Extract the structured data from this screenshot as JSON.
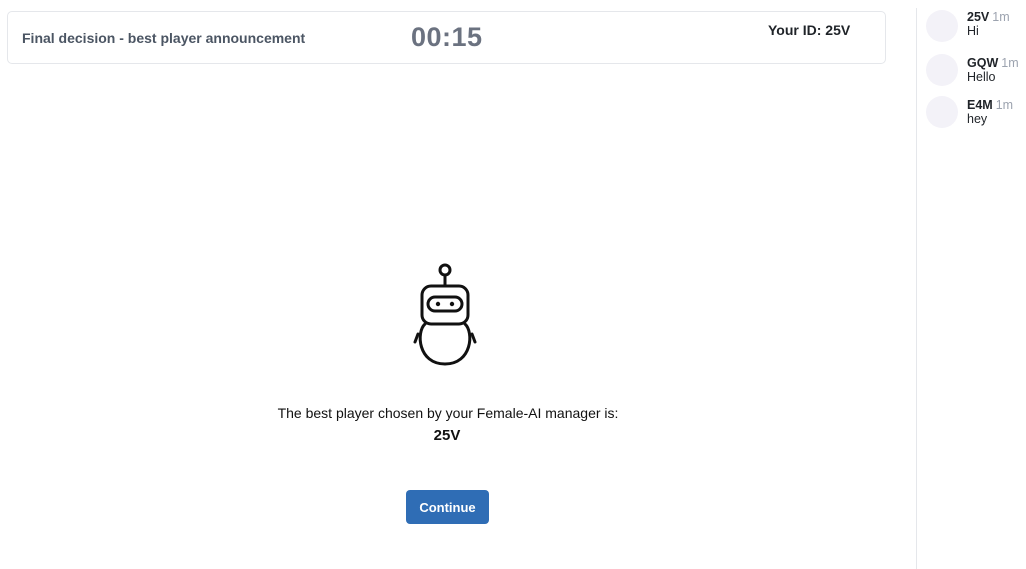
{
  "header": {
    "stage_title": "Final decision - best player announcement",
    "timer": "00:15",
    "your_id": "Your ID: 25V"
  },
  "main": {
    "robot_icon": "robot-icon",
    "announcement": "The best player chosen by your Female-AI manager is:",
    "winner": "25V",
    "continue_label": "Continue",
    "accent_color": "#2f6db5"
  },
  "chat": {
    "messages": [
      {
        "author": "25V",
        "time": "1m",
        "text": "Hi"
      },
      {
        "author": "GQW",
        "time": "1m",
        "text": "Hello"
      },
      {
        "author": "E4M",
        "time": "1m",
        "text": "hey"
      }
    ]
  }
}
